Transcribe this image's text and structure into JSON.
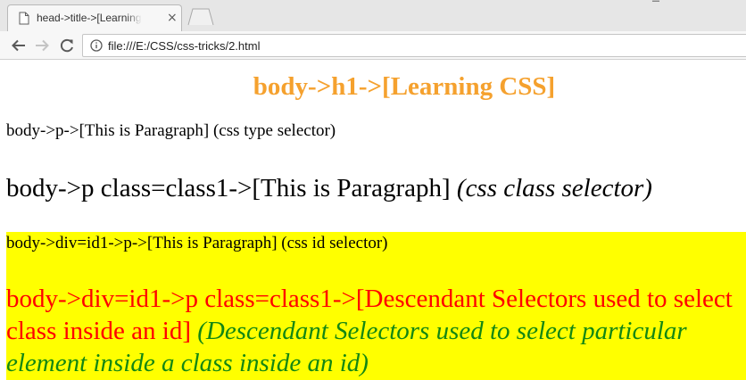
{
  "browser": {
    "tab": {
      "title": "head->title->[Learning CSS]",
      "close_glyph": "×"
    },
    "window_control_glyph": "–",
    "address_bar": {
      "url": "file:///E:/CSS/css-tricks/2.html"
    }
  },
  "page": {
    "h1": "body->h1->[Learning CSS]",
    "p_type": "body->p->[This is Paragraph] (css type selector)",
    "p_class1": {
      "text": "body->p class=class1->[This is Paragraph]",
      "em": "(css class selector)"
    },
    "div_id1": {
      "p_id": "body->div=id1->p->[This is Paragraph] (css id selector)",
      "p_desc": {
        "text": "body->div=id1->p class=class1->[Descendant Selectors used to select class inside an id]",
        "em": "(Descendant Selectors used to select particular element inside a class inside an id)"
      }
    }
  },
  "colors": {
    "h1": "#f5a12e",
    "id1_background": "#ffff00",
    "descendant_text": "#ff0000",
    "descendant_em": "#138713"
  }
}
